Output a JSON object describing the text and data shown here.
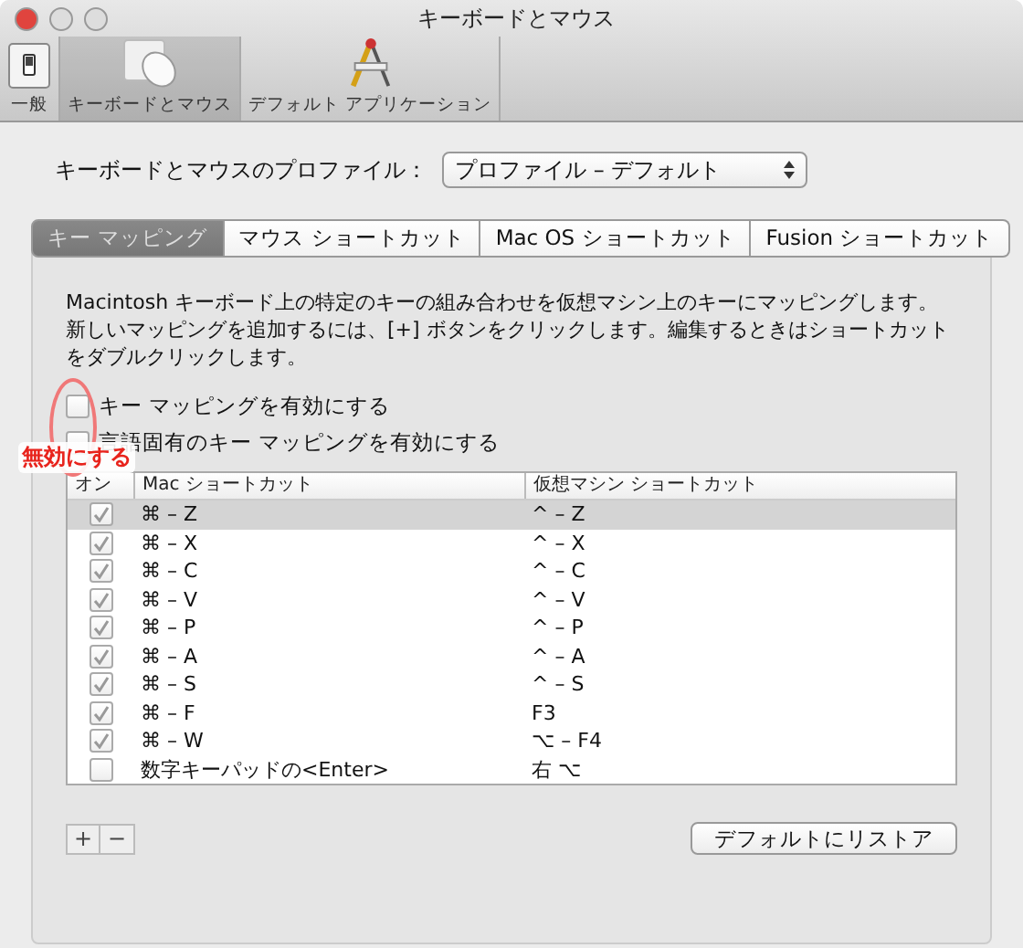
{
  "window": {
    "title": "キーボードとマウス"
  },
  "toolbar": [
    {
      "kind": "general",
      "label": "一般",
      "selected": false
    },
    {
      "kind": "mouse",
      "label": "キーボードとマウス",
      "selected": true
    },
    {
      "kind": "apps",
      "label": "デフォルト アプリケーション",
      "selected": false
    }
  ],
  "profile": {
    "label": "キーボードとマウスのプロファイル：",
    "value": "プロファイル – デフォルト"
  },
  "tabs": [
    {
      "label": "キー マッピング",
      "selected": true
    },
    {
      "label": "マウス ショートカット",
      "selected": false
    },
    {
      "label": "Mac OS ショートカット",
      "selected": false
    },
    {
      "label": "Fusion ショートカット",
      "selected": false
    }
  ],
  "description": "Macintosh キーボード上の特定のキーの組み合わせを仮想マシン上のキーにマッピングします。新しいマッピングを追加するには、[+] ボタンをクリックします。編集するときはショートカットをダブルクリックします。",
  "options": [
    {
      "label": "キー マッピングを有効にする",
      "checked": false
    },
    {
      "label": "言語固有のキー マッピングを有効にする",
      "checked": false
    }
  ],
  "table": {
    "columns": [
      "オン",
      "Mac ショートカット",
      "仮想マシン ショートカット"
    ],
    "rows": [
      {
        "on": true,
        "mac": "⌘ – Z",
        "vm": "^ – Z",
        "selected": true
      },
      {
        "on": true,
        "mac": "⌘ – X",
        "vm": "^ – X",
        "selected": false
      },
      {
        "on": true,
        "mac": "⌘ – C",
        "vm": "^ – C",
        "selected": false
      },
      {
        "on": true,
        "mac": "⌘ – V",
        "vm": "^ – V",
        "selected": false
      },
      {
        "on": true,
        "mac": "⌘ – P",
        "vm": "^ – P",
        "selected": false
      },
      {
        "on": true,
        "mac": "⌘ – A",
        "vm": "^ – A",
        "selected": false
      },
      {
        "on": true,
        "mac": "⌘ – S",
        "vm": "^ – S",
        "selected": false
      },
      {
        "on": true,
        "mac": "⌘ – F",
        "vm": "F3",
        "selected": false
      },
      {
        "on": true,
        "mac": "⌘ – W",
        "vm": "⌥ – F4",
        "selected": false
      },
      {
        "on": false,
        "mac": "数字キーパッドの<Enter>",
        "vm": "右 ⌥",
        "selected": false
      }
    ]
  },
  "list_buttons": [
    "+",
    "−"
  ],
  "restore_button": "デフォルトにリストア",
  "annotation": {
    "label": "無効にする"
  }
}
